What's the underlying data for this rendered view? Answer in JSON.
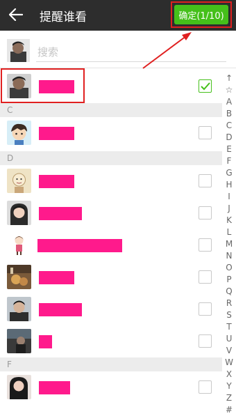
{
  "header": {
    "title": "提醒谁看",
    "confirm_label": "确定(1/10)"
  },
  "search": {
    "placeholder": "搜索"
  },
  "sections": {
    "c": "C",
    "d": "D",
    "f": "F"
  },
  "contacts": [
    {
      "avatar": "man-photo-avatar",
      "checked": true
    },
    {
      "avatar": "cartoon-boy-avatar",
      "checked": false
    },
    {
      "avatar": "cartoon-beige-avatar",
      "checked": false
    },
    {
      "avatar": "girl-photo-avatar",
      "checked": false
    },
    {
      "avatar": "cartoon-girl-avatar",
      "checked": false
    },
    {
      "avatar": "food-photo-avatar",
      "checked": false
    },
    {
      "avatar": "man-portrait-avatar",
      "checked": false
    },
    {
      "avatar": "dark-photo-avatar",
      "checked": false
    },
    {
      "avatar": "woman-photo-avatar",
      "checked": false
    }
  ],
  "index_letters": [
    "↑",
    "☆",
    "A",
    "B",
    "C",
    "D",
    "E",
    "F",
    "G",
    "H",
    "I",
    "J",
    "K",
    "L",
    "M",
    "N",
    "O",
    "P",
    "Q",
    "R",
    "S",
    "T",
    "U",
    "V",
    "W",
    "X",
    "Y",
    "Z",
    "#"
  ],
  "colors": {
    "topbar": "#2d2d2d",
    "confirm_green": "#45c01a",
    "redaction_pink": "#ff1a8c",
    "annotation_red": "#e02020"
  }
}
